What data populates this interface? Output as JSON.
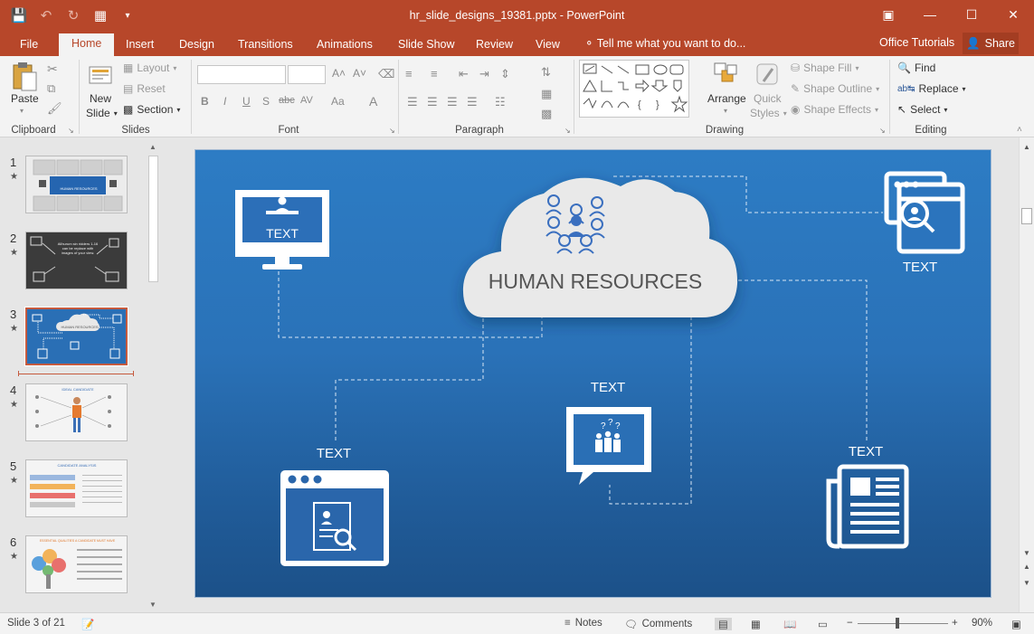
{
  "window": {
    "title": "hr_slide_designs_19381.pptx - PowerPoint",
    "buttons": [
      "restore-ribbon",
      "minimize",
      "maximize",
      "close"
    ]
  },
  "tabs": [
    "File",
    "Home",
    "Insert",
    "Design",
    "Transitions",
    "Animations",
    "Slide Show",
    "Review",
    "View"
  ],
  "tell_me": "Tell me what you want to do...",
  "office_tutorials": "Office Tutorials",
  "share": "Share",
  "ribbon": {
    "clipboard": {
      "label": "Clipboard",
      "paste": "Paste"
    },
    "slides": {
      "label": "Slides",
      "new_slide_line1": "New",
      "new_slide_line2": "Slide",
      "layout": "Layout",
      "reset": "Reset",
      "section": "Section"
    },
    "font": {
      "label": "Font",
      "bold": "B",
      "italic": "I",
      "underline": "U",
      "shadow": "S",
      "strike": "abc",
      "spacing": "AV",
      "case": "Aa",
      "grow": "A",
      "shrink": "A",
      "color": "A"
    },
    "paragraph": {
      "label": "Paragraph"
    },
    "drawing": {
      "label": "Drawing",
      "arrange": "Arrange",
      "quick_styles_line1": "Quick",
      "quick_styles_line2": "Styles",
      "shape_fill": "Shape Fill",
      "shape_outline": "Shape Outline",
      "shape_effects": "Shape Effects"
    },
    "editing": {
      "label": "Editing",
      "find": "Find",
      "replace": "Replace",
      "select": "Select"
    }
  },
  "thumbnails": [
    {
      "num": "1",
      "star": "★"
    },
    {
      "num": "2",
      "star": "★"
    },
    {
      "num": "3",
      "star": "★"
    },
    {
      "num": "4",
      "star": "★"
    },
    {
      "num": "5",
      "star": "★"
    },
    {
      "num": "6",
      "star": "★"
    }
  ],
  "thumb_text": {
    "t1": "HUMAN RESOURCES",
    "t2_line1": "Allhurum sin ridders 1-16",
    "t2_line2": "can be replace with",
    "t2_line3": "images of your view.",
    "t3": "HUMAN RESOURCES",
    "t4": "IDEAL CANDIDATE",
    "t5": "CANDIDATE ANALYSIS",
    "t6": "ESSENTIAL QUALITIES A CANDIDATE MUST HAVE"
  },
  "slide": {
    "title": "HUMAN RESOURCES",
    "labels": [
      "TEXT",
      "TEXT",
      "TEXT",
      "TEXT",
      "TEXT",
      "TEXT"
    ]
  },
  "status": {
    "slide_of": "Slide 3 of 21",
    "notes": "Notes",
    "comments": "Comments",
    "zoom": "90%"
  },
  "colors": {
    "accent": "#b7472a",
    "slide_top": "#2d7cc4",
    "slide_bottom": "#1c5189"
  }
}
